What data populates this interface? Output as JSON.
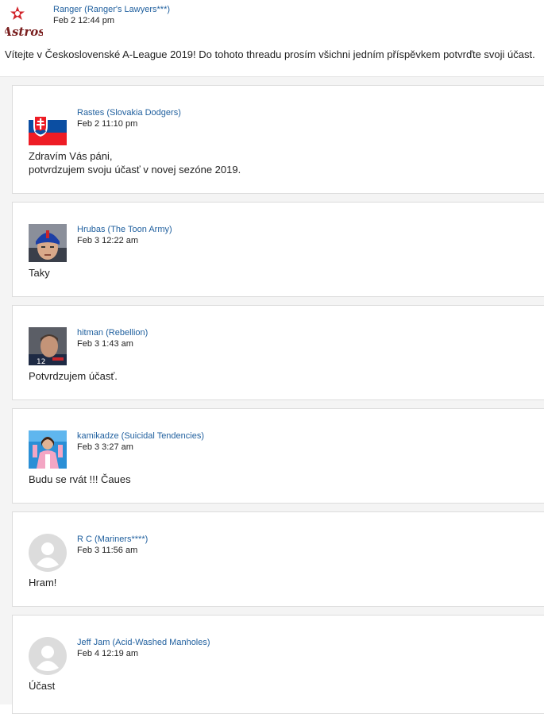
{
  "op": {
    "avatar_icon": "astros-logo",
    "avatar_text": "Astros",
    "user": "Ranger",
    "team": "Ranger's Lawyers***",
    "date": "Feb 2 12:44 pm",
    "text": "Vítejte v Československé A-League 2019! Do tohoto threadu prosím všichni jedním příspěvkem potvrďte svoji účast."
  },
  "replies": [
    {
      "user": "Rastes",
      "team": "Slovakia Dodgers",
      "date": "Feb 2 11:10 pm",
      "avatar": "slovakia-flag-avatar",
      "lines": [
        "Zdravím Vás páni,",
        "potvrdzujem svoju účasť v novej sezóne 2019."
      ]
    },
    {
      "user": "Hrubas",
      "team": "The Toon Army",
      "date": "Feb 3 12:22 am",
      "avatar": "hockey-player-avatar",
      "lines": [
        "Taky"
      ]
    },
    {
      "user": "hitman",
      "team": "Rebellion",
      "date": "Feb 3 1:43 am",
      "avatar": "football-player-avatar",
      "lines": [
        "Potvrdzujem účasť."
      ]
    },
    {
      "user": "kamikadze",
      "team": "Suicidal Tendencies",
      "date": "Feb 3 3:27 am",
      "avatar": "woman-photo-avatar",
      "lines": [
        "Budu se rvát !!! Čaues"
      ]
    },
    {
      "user": "R C",
      "team": "Mariners****",
      "date": "Feb 3 11:56 am",
      "avatar": "default-user-avatar",
      "lines": [
        "Hram!"
      ]
    },
    {
      "user": "Jeff Jam",
      "team": "Acid-Washed Manholes",
      "date": "Feb 4 12:19 am",
      "avatar": "default-user-avatar",
      "lines": [
        "Účast"
      ]
    }
  ]
}
